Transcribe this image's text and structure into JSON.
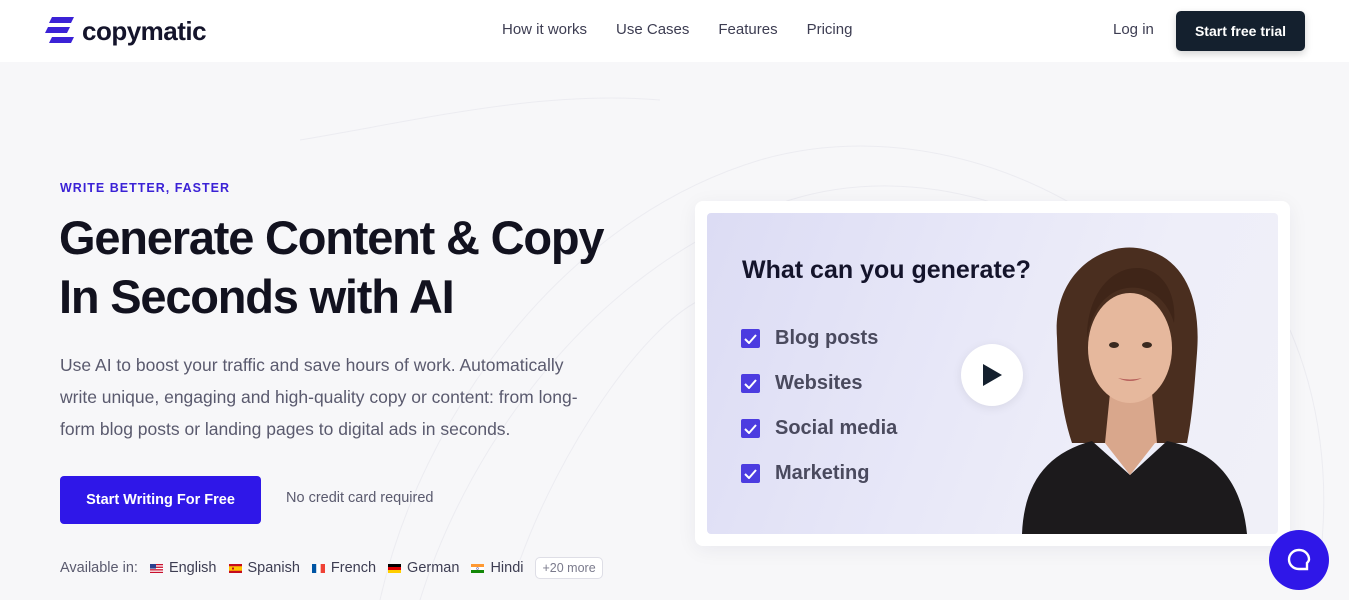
{
  "brand": {
    "name": "copymatic",
    "accent": "#2f17e8",
    "dark": "#14202e"
  },
  "nav": {
    "items": [
      "How it works",
      "Use Cases",
      "Features",
      "Pricing"
    ],
    "login": "Log in",
    "cta": "Start free trial"
  },
  "hero": {
    "eyebrow": "WRITE BETTER, FASTER",
    "title_line1": "Generate Content & Copy",
    "title_line2": "In Seconds with AI",
    "description": "Use AI to boost your traffic and save hours of work. Automatically write unique, engaging and high-quality copy or content: from long-form blog posts or landing pages to digital ads in seconds.",
    "cta": "Start Writing For Free",
    "note": "No credit card required"
  },
  "languages": {
    "label": "Available in:",
    "items": [
      "English",
      "Spanish",
      "French",
      "German",
      "Hindi"
    ],
    "more": "+20 more"
  },
  "video": {
    "title": "What can you generate?",
    "items": [
      "Blog posts",
      "Websites",
      "Social media",
      "Marketing"
    ],
    "play_icon": "play-icon"
  },
  "chat": {
    "icon": "chat-icon"
  }
}
